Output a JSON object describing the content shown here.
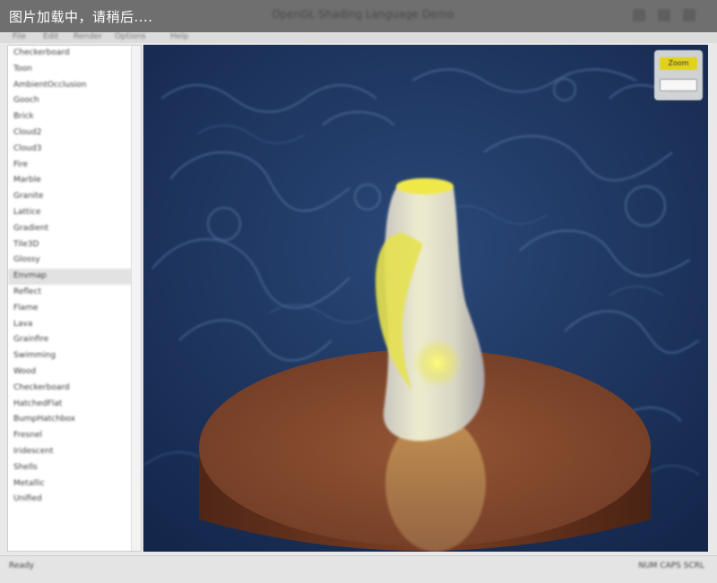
{
  "window": {
    "loading_text": "图片加载中，请稍后....",
    "title": "OpenGL Shading Language Demo",
    "controls": [
      "minimize-icon",
      "maximize-icon",
      "close-icon"
    ]
  },
  "menu": {
    "items": [
      "File",
      "Edit",
      "Render",
      "Options",
      "Help"
    ]
  },
  "examples": {
    "items": [
      "Checkerboard",
      "Toon",
      "AmbientOcclusion",
      "Gooch",
      "Brick",
      "Cloud2",
      "Cloud3",
      "Fire",
      "Marble",
      "Granite",
      "Lattice",
      "Gradient",
      "Tile3D",
      "Glossy",
      "Envmap",
      "Reflect",
      "Flame",
      "Lava",
      "Grainfire",
      "Swimming",
      "Wood",
      "Checkerboard",
      "HatchedFlat",
      "BumpHatchbox",
      "Fresnel",
      "Iridescent",
      "Shells",
      "Metallic",
      "Unified"
    ],
    "selected_index": 14
  },
  "viewport": {
    "zoom_label": "Zoom",
    "background_color": "#1c3158",
    "model_color": "#f2ef8a",
    "pedestal_color": "#8a4a2c"
  },
  "status": {
    "left": "Ready",
    "right": "NUM   CAPS   SCRL"
  }
}
